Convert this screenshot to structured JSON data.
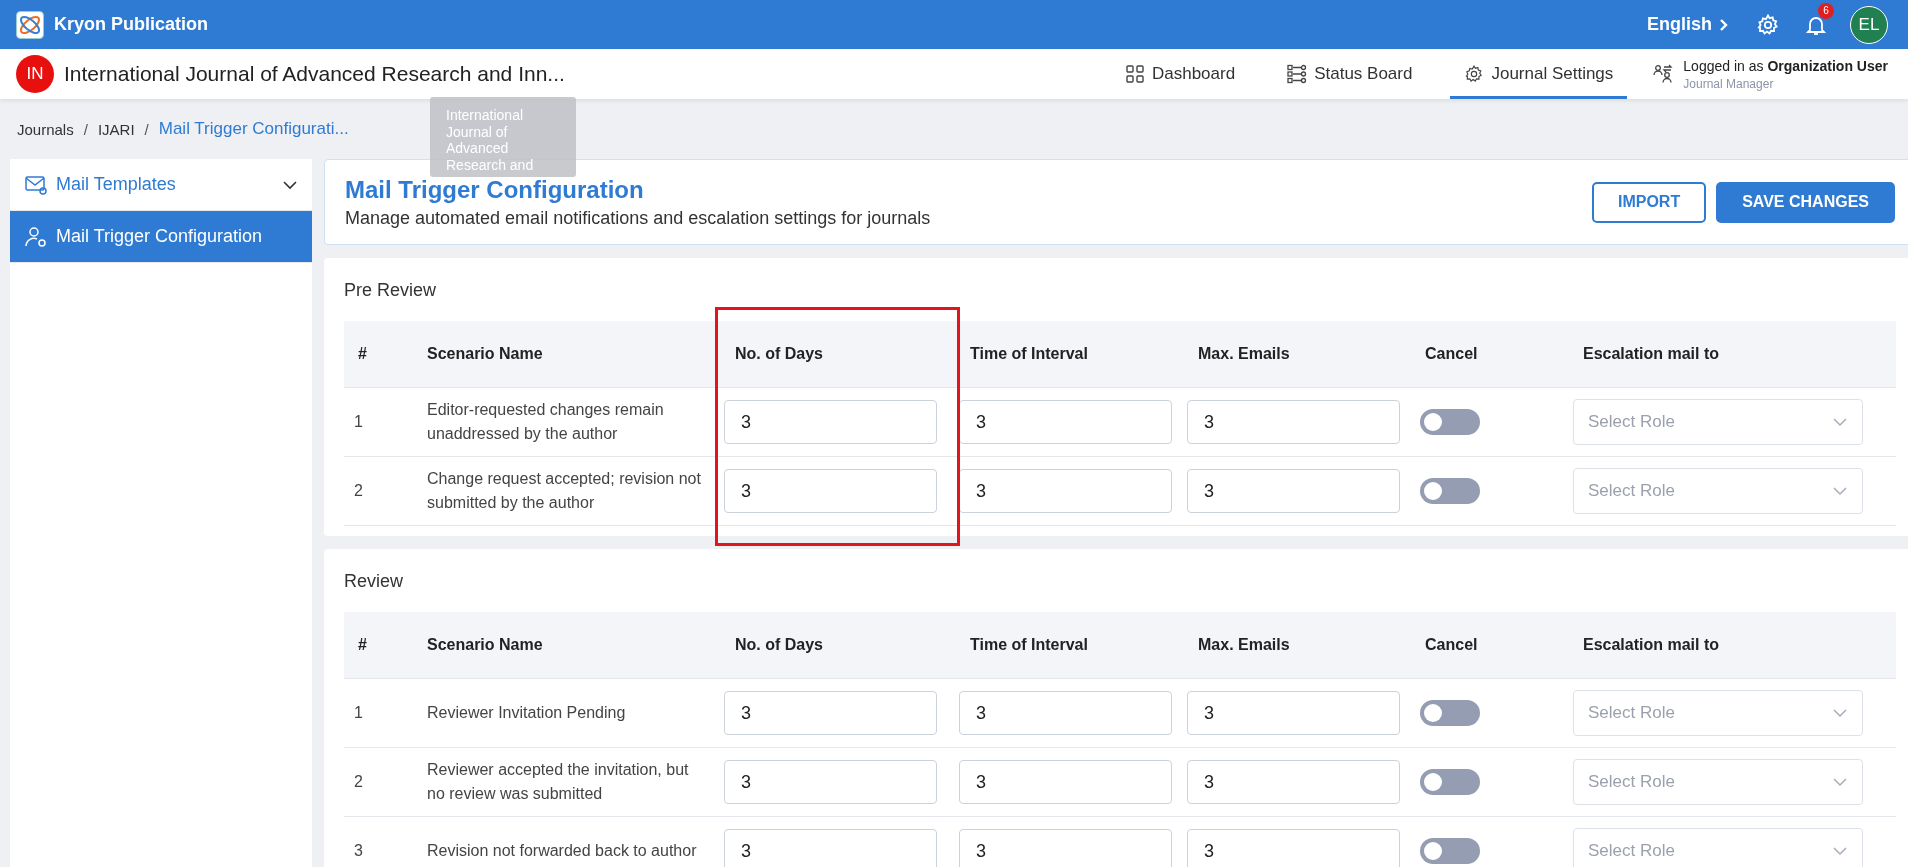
{
  "app": {
    "name": "Kryon Publication",
    "language": "English",
    "notifications": "6",
    "avatar": "EL"
  },
  "journal": {
    "badge": "IN",
    "title": "International Journal of Advanced Research and Inn...",
    "tooltip": "International Journal of Advanced Research and"
  },
  "nav": [
    {
      "label": "Dashboard",
      "kind": "grid",
      "selected": false
    },
    {
      "label": "Status Board",
      "kind": "board",
      "selected": false
    },
    {
      "label": "Journal Settings",
      "kind": "gear",
      "selected": true
    }
  ],
  "user": {
    "prefix": "Logged in as ",
    "name": "Organization User",
    "role": "Journal Manager"
  },
  "breadcrumb": [
    {
      "label": "Journals",
      "selected": false
    },
    {
      "separator": "/",
      "label": "IJARI",
      "selected": false
    },
    {
      "separator": "/",
      "label": "Mail Trigger Configurati...",
      "selected": true
    }
  ],
  "sidebar": {
    "items": [
      {
        "label": "Mail Templates",
        "kind": "group",
        "selected": false
      },
      {
        "label": "Mail Trigger Configuration",
        "kind": "page",
        "selected": true
      }
    ]
  },
  "header": {
    "title": "Mail Trigger Configuration",
    "subtitle": "Manage automated email notifications and escalation settings for journals",
    "buttons": [
      {
        "label": "IMPORT",
        "kind": "outline"
      },
      {
        "label": "SAVE CHANGES",
        "kind": "primary"
      }
    ]
  },
  "sections": [
    {
      "title": "Pre Review",
      "columns": [
        {
          "label": "#",
          "highlighted": false
        },
        {
          "label": "Scenario Name",
          "highlighted": false
        },
        {
          "label": "No. of Days",
          "highlighted": true
        },
        {
          "label": "Time of Interval",
          "highlighted": false
        },
        {
          "label": "Max. Emails",
          "highlighted": false
        },
        {
          "label": "Cancel",
          "highlighted": false
        },
        {
          "label": "Escalation mail to",
          "highlighted": false
        }
      ],
      "rows": [
        {
          "index": "1",
          "scenario": "Editor-requested changes remain unaddressed by the author",
          "days": "3",
          "interval": "3",
          "max_emails": "3",
          "cancel": false,
          "escalation_placeholder": "Select Role"
        },
        {
          "index": "2",
          "scenario": "Change request accepted; revision not submitted by the author",
          "days": "3",
          "interval": "3",
          "max_emails": "3",
          "cancel": false,
          "escalation_placeholder": "Select Role"
        }
      ]
    },
    {
      "title": "Review",
      "columns": [
        {
          "label": "#",
          "highlighted": false
        },
        {
          "label": "Scenario Name",
          "highlighted": false
        },
        {
          "label": "No. of Days",
          "highlighted": false
        },
        {
          "label": "Time of Interval",
          "highlighted": false
        },
        {
          "label": "Max. Emails",
          "highlighted": false
        },
        {
          "label": "Cancel",
          "highlighted": false
        },
        {
          "label": "Escalation mail to",
          "highlighted": false
        }
      ],
      "rows": [
        {
          "index": "1",
          "scenario": "Reviewer Invitation Pending",
          "days": "3",
          "interval": "3",
          "max_emails": "3",
          "cancel": false,
          "escalation_placeholder": "Select Role"
        },
        {
          "index": "2",
          "scenario": "Reviewer accepted the invitation, but no review was submitted",
          "days": "3",
          "interval": "3",
          "max_emails": "3",
          "cancel": false,
          "escalation_placeholder": "Select Role"
        },
        {
          "index": "3",
          "scenario": "Revision not forwarded back to author",
          "days": "3",
          "interval": "3",
          "max_emails": "3",
          "cancel": false,
          "escalation_placeholder": "Select Role"
        }
      ]
    }
  ]
}
